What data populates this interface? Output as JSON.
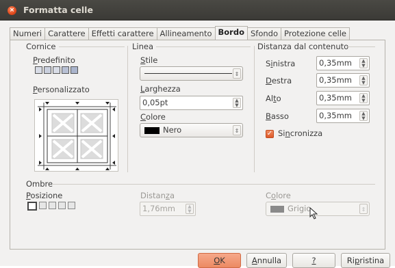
{
  "window": {
    "title": "Formatta celle"
  },
  "tabs": [
    "Numeri",
    "Carattere",
    "Effetti carattere",
    "Allineamento",
    "Bordo",
    "Sfondo",
    "Protezione celle"
  ],
  "active_tab": "Bordo",
  "cornice": {
    "label": "Cornice",
    "predefinito": {
      "label_u": "P",
      "label_rest": "redefinito"
    },
    "personalizzato": {
      "label_u": "P",
      "label_rest": "ersonalizzato"
    }
  },
  "linea": {
    "label": "Linea",
    "stile": {
      "label_u": "S",
      "label_rest": "tile"
    },
    "larghezza": {
      "label_u": "L",
      "label_rest": "arghezza",
      "value": "0,05pt"
    },
    "colore": {
      "label_u": "C",
      "label_rest": "olore",
      "value": "Nero",
      "swatch": "#000000"
    }
  },
  "distanza": {
    "label": "Distanza dal contenuto",
    "fields": [
      {
        "pre": "S",
        "u": "i",
        "post": "nistra",
        "value": "0,35mm"
      },
      {
        "pre": "",
        "u": "D",
        "post": "estra",
        "value": "0,35mm"
      },
      {
        "pre": "Al",
        "u": "t",
        "post": "o",
        "value": "0,35mm"
      },
      {
        "pre": "",
        "u": "B",
        "post": "asso",
        "value": "0,35mm"
      }
    ],
    "sincronizza": {
      "pre": "Si",
      "u": "n",
      "post": "cronizza",
      "checked": true
    }
  },
  "ombre": {
    "label": "Ombre",
    "posizione": {
      "label_u": "P",
      "label_rest": "osizione"
    },
    "distanza": {
      "pre": "Distan",
      "u": "z",
      "post": "a",
      "value": "1,76mm"
    },
    "colore": {
      "pre": "C",
      "u": "o",
      "post": "lore",
      "value": "Grigio",
      "swatch": "#888888"
    }
  },
  "buttons": {
    "ok": {
      "u": "O",
      "rest": "K"
    },
    "annulla": {
      "u": "A",
      "rest": "nnulla"
    },
    "help": {
      "u": "?",
      "rest": ""
    },
    "ripristina": {
      "pre": "Ri",
      "u": "p",
      "post": "ristina"
    }
  },
  "colors": {
    "accent": "#ec8a63",
    "titlebar": "#3b3a36",
    "dialog_bg": "#f2f1f0"
  }
}
